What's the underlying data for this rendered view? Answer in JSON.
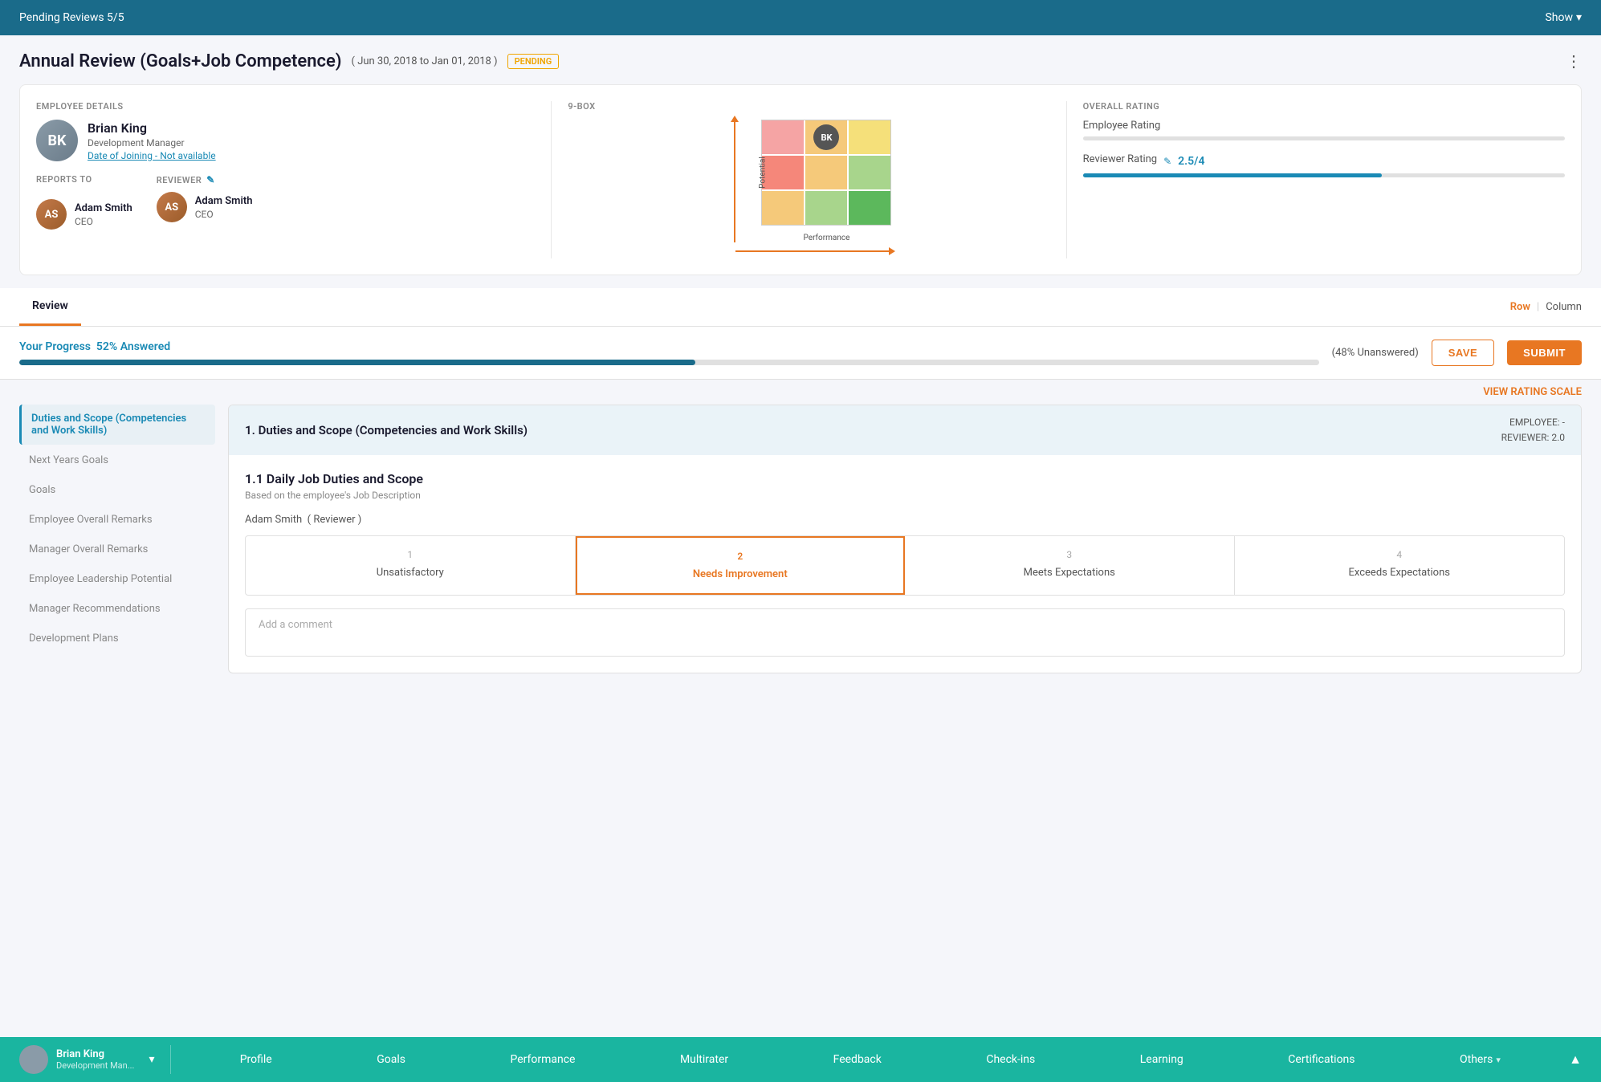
{
  "topBar": {
    "pendingReviews": "Pending Reviews 5/5",
    "show": "Show"
  },
  "pageHeader": {
    "title": "Annual Review (Goals+Job Competence)",
    "dateRange": "( Jun 30, 2018 to Jan 01, 2018 )",
    "badge": "PENDING",
    "moreIcon": "⋮"
  },
  "employeeDetails": {
    "sectionLabel": "EMPLOYEE DETAILS",
    "name": "Brian King",
    "role": "Development Manager",
    "joinDate": "Date of Joining - Not available",
    "reportsToLabel": "REPORTS TO",
    "reportsToName": "Adam Smith",
    "reportsToRole": "CEO",
    "reviewerLabel": "REVIEWER",
    "reviewerName": "Adam Smith",
    "reviewerRole": "CEO"
  },
  "nineBox": {
    "sectionLabel": "9-BOX",
    "yAxisLabel": "Potential",
    "xAxisLabel": "Performance",
    "bubble": "BK"
  },
  "overallRating": {
    "sectionLabel": "OVERALL RATING",
    "employeeRatingLabel": "Employee Rating",
    "reviewerRatingLabel": "Reviewer Rating",
    "reviewerRatingValue": "2.5/4",
    "reviewerRatingPercent": 62
  },
  "tabs": {
    "activeTab": "Review",
    "tabs": [
      "Review"
    ],
    "rowLabel": "Row",
    "columnLabel": "Column"
  },
  "progress": {
    "title": "Your Progress",
    "answered": "52% Answered",
    "unanswered": "(48% Unanswered)",
    "percent": 52,
    "saveLabel": "SAVE",
    "submitLabel": "SUBMIT"
  },
  "ratingScaleLink": "VIEW RATING SCALE",
  "sidebar": {
    "items": [
      {
        "label": "Duties and Scope (Competencies and Work Skills)",
        "active": true
      },
      {
        "label": "Next Years Goals",
        "active": false
      },
      {
        "label": "Goals",
        "active": false
      },
      {
        "label": "Employee Overall Remarks",
        "active": false
      },
      {
        "label": "Manager Overall Remarks",
        "active": false
      },
      {
        "label": "Employee Leadership Potential",
        "active": false
      },
      {
        "label": "Manager Recommendations",
        "active": false
      },
      {
        "label": "Development Plans",
        "active": false
      }
    ]
  },
  "reviewSection": {
    "sectionNumber": "1.",
    "sectionTitle": "Duties and Scope (Competencies and Work Skills)",
    "employeeScore": "EMPLOYEE: -",
    "reviewerScore": "REVIEWER: 2.0",
    "subsectionTitle": "1.1 Daily Job Duties and Scope",
    "subsectionDesc": "Based on the employee's Job Description",
    "reviewerName": "Adam Smith",
    "reviewerTag": "( Reviewer )",
    "ratingOptions": [
      {
        "number": "1",
        "label": "Unsatisfactory",
        "selected": false,
        "highlighted": false
      },
      {
        "number": "2",
        "label": "Needs Improvement",
        "selected": true,
        "highlighted": true
      },
      {
        "number": "3",
        "label": "Meets Expectations",
        "selected": false,
        "highlighted": false
      },
      {
        "number": "4",
        "label": "Exceeds Expectations",
        "selected": false,
        "highlighted": false
      }
    ],
    "commentPlaceholder": "Add a comment"
  },
  "bottomNav": {
    "employeeName": "Brian King",
    "employeeRole": "Development Man...",
    "navItems": [
      "Profile",
      "Goals",
      "Performance",
      "Multirater",
      "Feedback",
      "Check-ins",
      "Learning",
      "Certifications"
    ],
    "others": "Others",
    "collapseIcon": "▲"
  }
}
